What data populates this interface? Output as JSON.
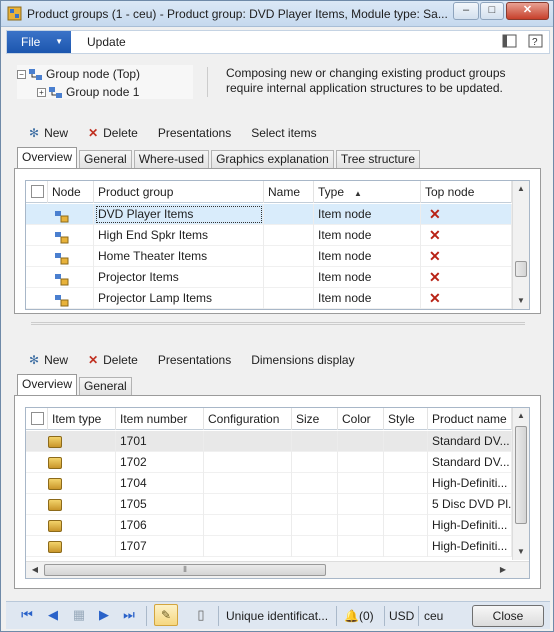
{
  "window": {
    "title": "Product groups (1 - ceu) - Product group: DVD Player Items, Module type: Sa...",
    "minimize": "–",
    "maximize": "□",
    "close": "✕"
  },
  "ribbon": {
    "file_label": "File",
    "update_tab": "Update"
  },
  "tree": {
    "root": "Group node (Top)",
    "child": "Group node 1"
  },
  "info_text": "Composing new or changing existing product groups require internal application structures to be updated.",
  "toolbar1": {
    "new": "New",
    "delete": "Delete",
    "presentations": "Presentations",
    "select_items": "Select items"
  },
  "tabs1": [
    "Overview",
    "General",
    "Where-used",
    "Graphics explanation",
    "Tree structure"
  ],
  "grid1": {
    "headers": [
      "Node",
      "Product group",
      "Name",
      "Type",
      "Top node"
    ],
    "rows": [
      {
        "group": "DVD Player Items",
        "name": "",
        "type": "Item node",
        "top": "✕"
      },
      {
        "group": "High End Spkr Items",
        "name": "",
        "type": "Item node",
        "top": "✕"
      },
      {
        "group": "Home Theater Items",
        "name": "",
        "type": "Item node",
        "top": "✕"
      },
      {
        "group": "Projector Items",
        "name": "",
        "type": "Item node",
        "top": "✕"
      },
      {
        "group": "Projector Lamp Items",
        "name": "",
        "type": "Item node",
        "top": "✕"
      }
    ]
  },
  "toolbar2": {
    "new": "New",
    "delete": "Delete",
    "presentations": "Presentations",
    "dimensions_display": "Dimensions display"
  },
  "tabs2": [
    "Overview",
    "General"
  ],
  "grid2": {
    "headers": [
      "Item type",
      "Item number",
      "Configuration",
      "Size",
      "Color",
      "Style",
      "Product name"
    ],
    "rows": [
      {
        "number": "1701",
        "product": "Standard DV..."
      },
      {
        "number": "1702",
        "product": "Standard DV..."
      },
      {
        "number": "1704",
        "product": "High-Definiti..."
      },
      {
        "number": "1705",
        "product": "5 Disc DVD Pl..."
      },
      {
        "number": "1706",
        "product": "High-Definiti..."
      },
      {
        "number": "1707",
        "product": "High-Definiti..."
      }
    ]
  },
  "statusbar": {
    "unique_id": "Unique identificat...",
    "alerts": "(0)",
    "currency": "USD",
    "company": "ceu",
    "close_label": "Close"
  }
}
